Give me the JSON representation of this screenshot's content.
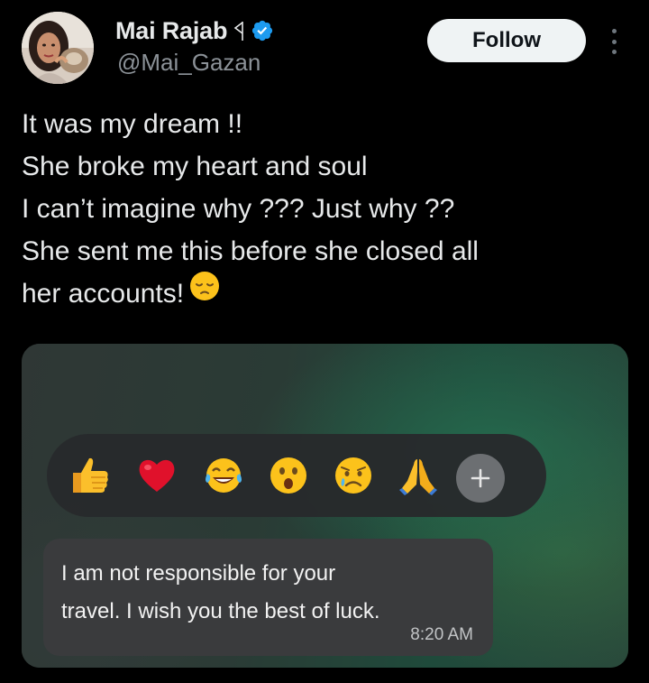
{
  "author": {
    "display_name": "Mai Rajab",
    "handle": "@Mai_Gazan",
    "verified": true,
    "verified_color": "#1d9bf0",
    "avatar_icon": "profile-photo"
  },
  "actions": {
    "follow_label": "Follow",
    "more_icon": "more-vertical-icon"
  },
  "tweet": {
    "lines": [
      "It was my dream !!",
      "She broke my heart and soul",
      "I can’t imagine why ??? Just why ??",
      "She sent me this before she closed all",
      "her accounts!"
    ],
    "trailing_emoji": "pensive-face"
  },
  "media": {
    "reactions": [
      "thumbs-up",
      "red-heart",
      "tears-of-joy",
      "surprised-face",
      "crying-face",
      "folded-hands"
    ],
    "add_reaction_icon": "plus-icon",
    "message": {
      "lines": [
        "I am not responsible for your",
        "travel. I wish you the best of luck."
      ],
      "time": "8:20 AM"
    }
  },
  "colors": {
    "background": "#000000",
    "text": "#e7e9ea",
    "muted": "#8b9197",
    "follow_bg": "#eff3f4"
  }
}
